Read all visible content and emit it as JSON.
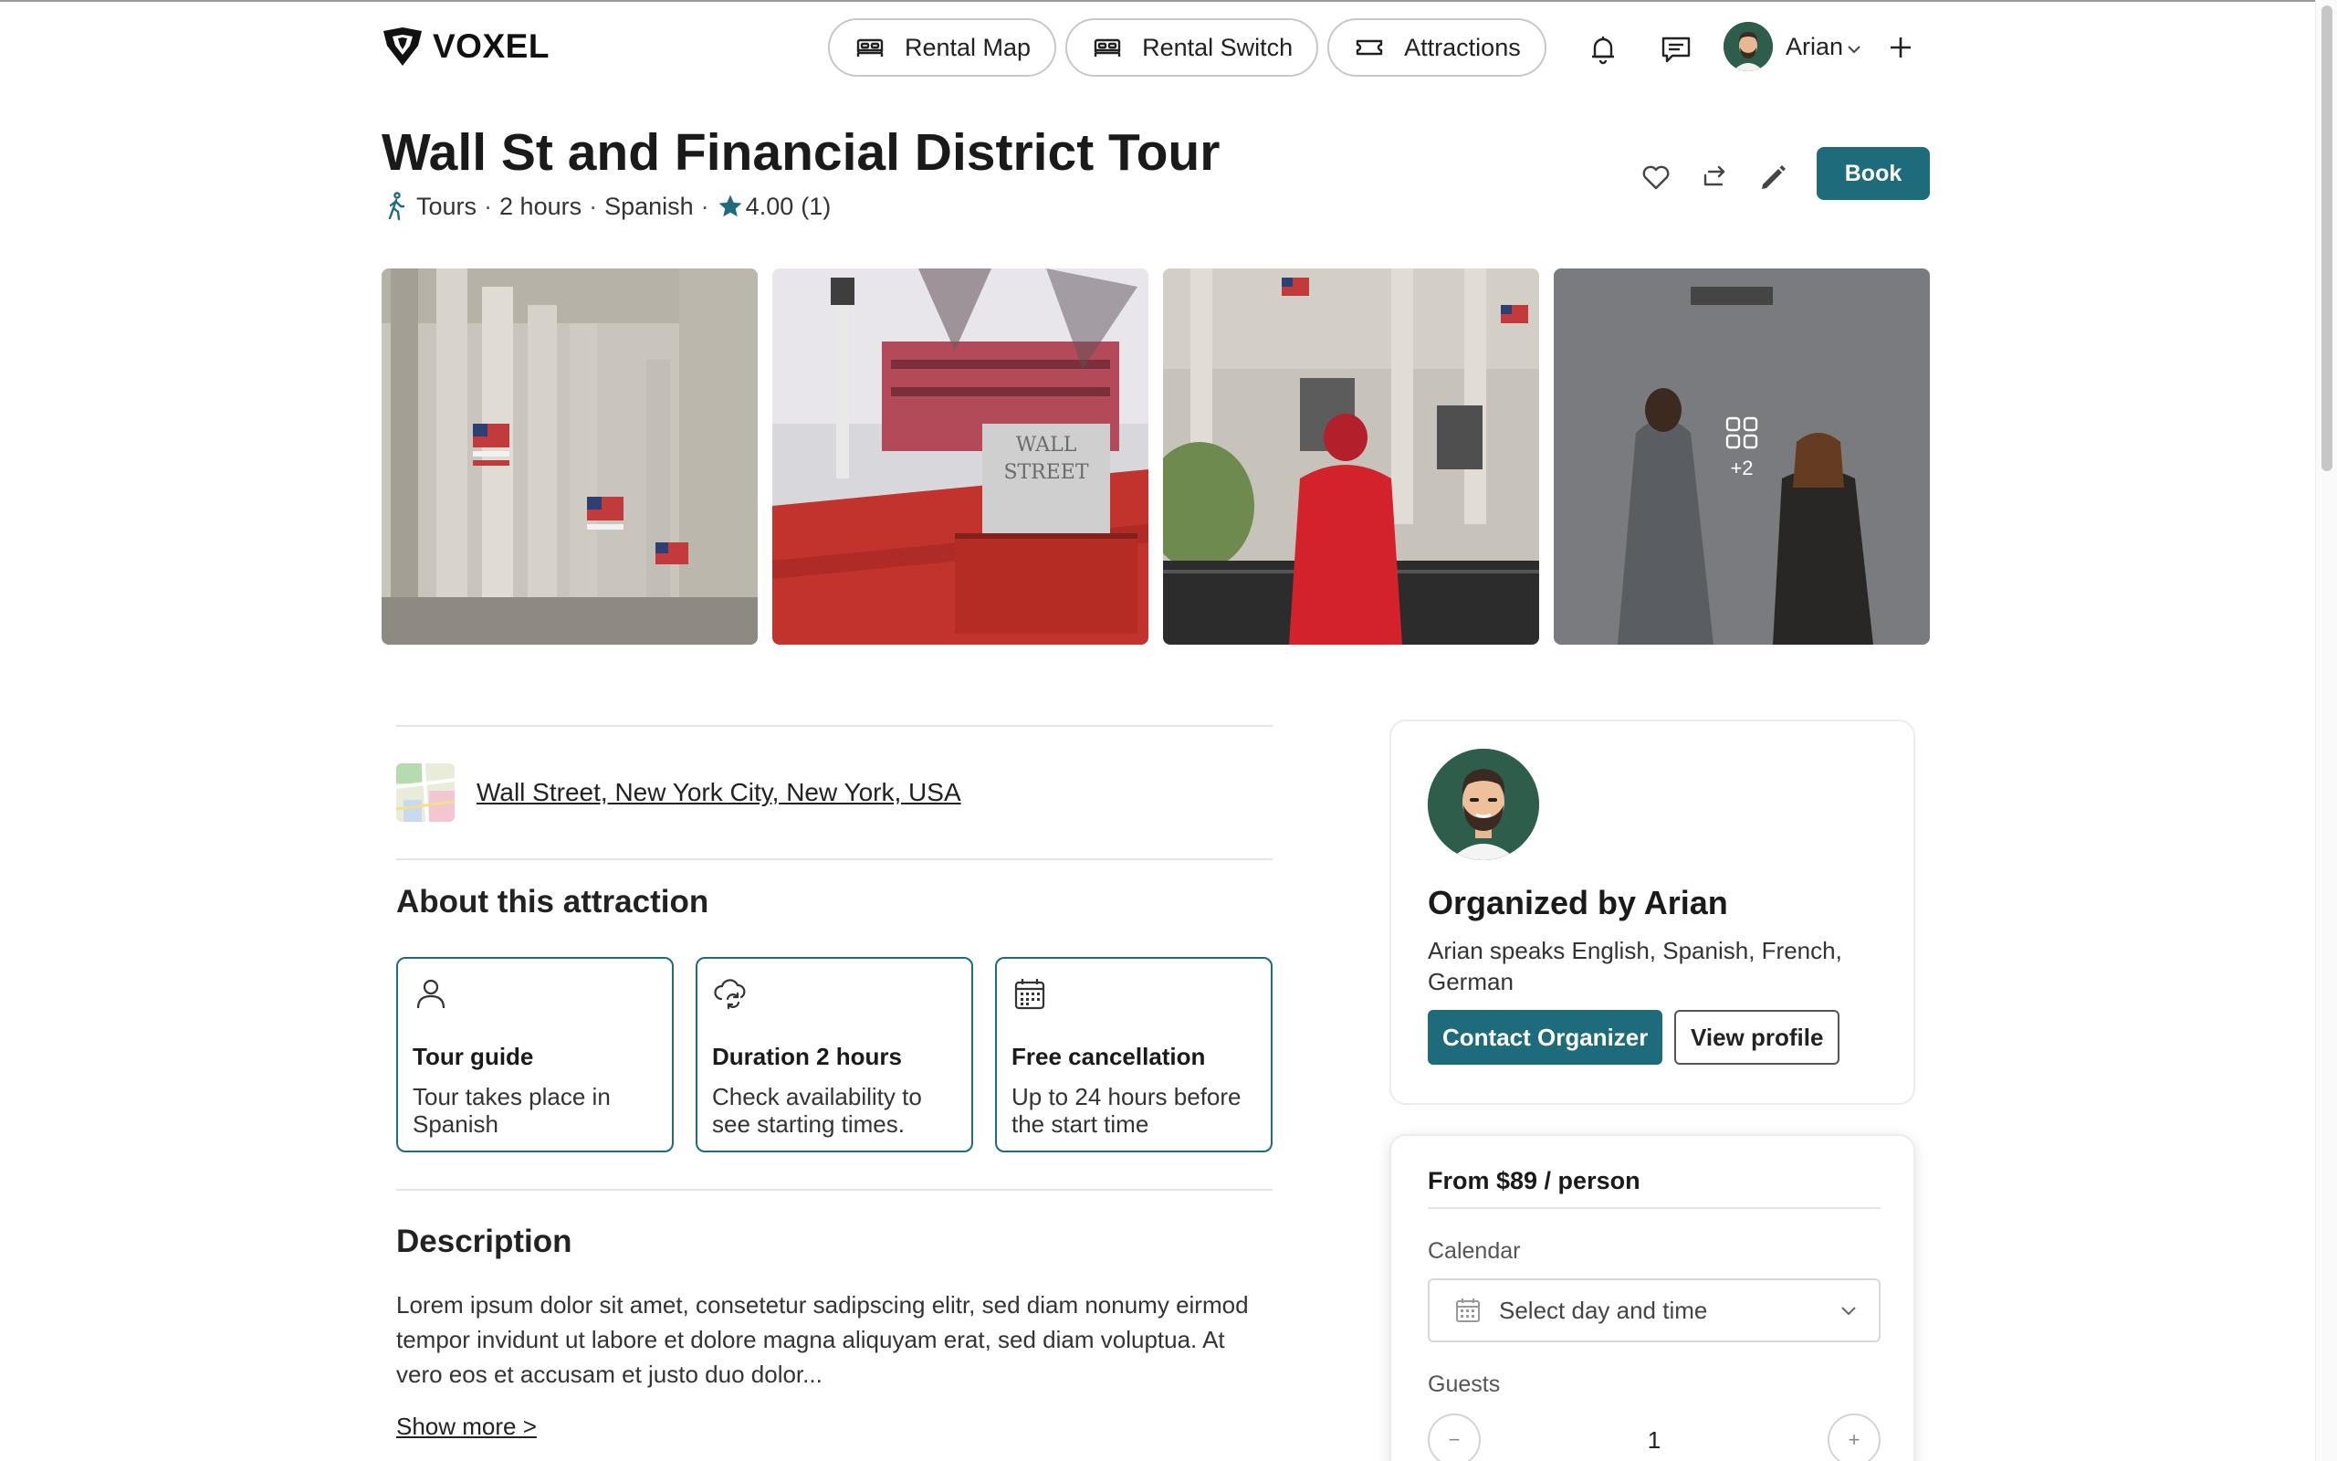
{
  "header": {
    "brand": "VOXEL",
    "nav": [
      {
        "label": "Rental Map",
        "icon": "bed-icon"
      },
      {
        "label": "Rental Switch",
        "icon": "bed-icon"
      },
      {
        "label": "Attractions",
        "icon": "ticket-icon"
      }
    ],
    "user_name": "Arian"
  },
  "listing": {
    "title": "Wall St and Financial District Tour",
    "category": "Tours",
    "duration": "2 hours",
    "language": "Spanish",
    "rating": "4.00",
    "reviews": "(1)",
    "book_label": "Book"
  },
  "gallery": {
    "more_count": "+2"
  },
  "location": {
    "address": "Wall Street, New York City, New York, USA"
  },
  "about": {
    "heading": "About this attraction",
    "cards": [
      {
        "title": "Tour guide",
        "desc": "Tour takes place in Spanish",
        "icon": "person-icon"
      },
      {
        "title": "Duration 2 hours",
        "desc": "Check availability to see starting times.",
        "icon": "cloud-sync-icon"
      },
      {
        "title": "Free cancellation",
        "desc": "Up to 24 hours before the start time",
        "icon": "calendar-icon"
      }
    ]
  },
  "description": {
    "heading": "Description",
    "text": "Lorem ipsum dolor sit amet, consetetur sadipscing elitr, sed diam nonumy eirmod tempor invidunt ut labore et dolore magna aliquyam erat, sed diam voluptua. At vero eos et accusam et justo duo dolor...",
    "show_more": "Show more >"
  },
  "organizer": {
    "name": "Organized by Arian",
    "languages": "Arian speaks English, Spanish, French, German",
    "contact_label": "Contact Organizer",
    "view_label": "View profile"
  },
  "booking": {
    "price": "From $89 / person",
    "calendar_label": "Calendar",
    "calendar_placeholder": "Select day and time",
    "guests_label": "Guests",
    "guests_value": "1",
    "minus": "−",
    "plus": "+"
  },
  "colors": {
    "accent": "#1e6b7b"
  }
}
